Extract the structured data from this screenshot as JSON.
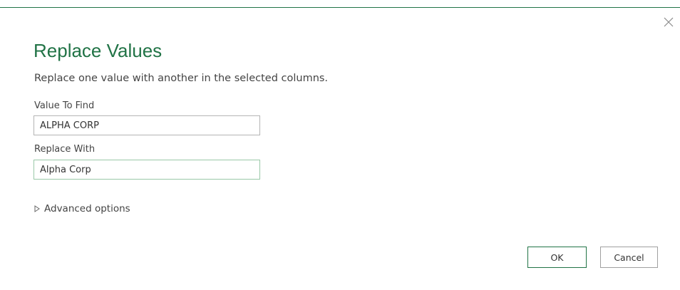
{
  "dialog": {
    "title": "Replace Values",
    "description": "Replace one value with another in the selected columns.",
    "accent_color": "#217346",
    "close_icon": "close-icon"
  },
  "find": {
    "label": "Value To Find",
    "value": "ALPHA CORP"
  },
  "replace": {
    "label": "Replace With",
    "value": "Alpha Corp"
  },
  "advanced": {
    "icon": "triangle-right-icon",
    "label": "Advanced options"
  },
  "buttons": {
    "ok_label": "OK",
    "cancel_label": "Cancel"
  }
}
